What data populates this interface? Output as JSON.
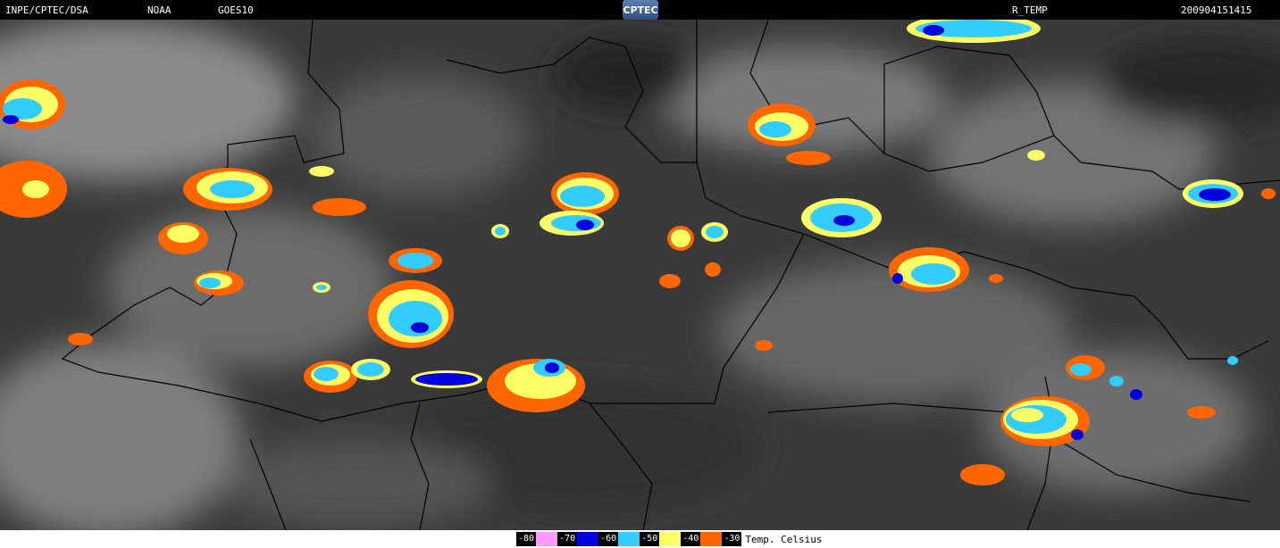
{
  "header": {
    "source": "INPE/CPTEC/DSA",
    "agency": "NOAA",
    "satellite": "GOES10",
    "logo_text": "CPTEC",
    "product": "R_TEMP",
    "timestamp": "200904151415"
  },
  "legend": {
    "items": [
      {
        "label": "-80",
        "color": "#ff99ff"
      },
      {
        "label": "-70",
        "color": "#0000dd"
      },
      {
        "label": "-60",
        "color": "#33ccff"
      },
      {
        "label": "-50",
        "color": "#ffff66"
      },
      {
        "label": "-40",
        "color": "#ff6600"
      },
      {
        "label": "-30",
        "color": ""
      }
    ],
    "unit": "Temp. Celsius"
  },
  "colors": {
    "background_cloud": "#3c3c3c",
    "border_lines": "#000000"
  }
}
